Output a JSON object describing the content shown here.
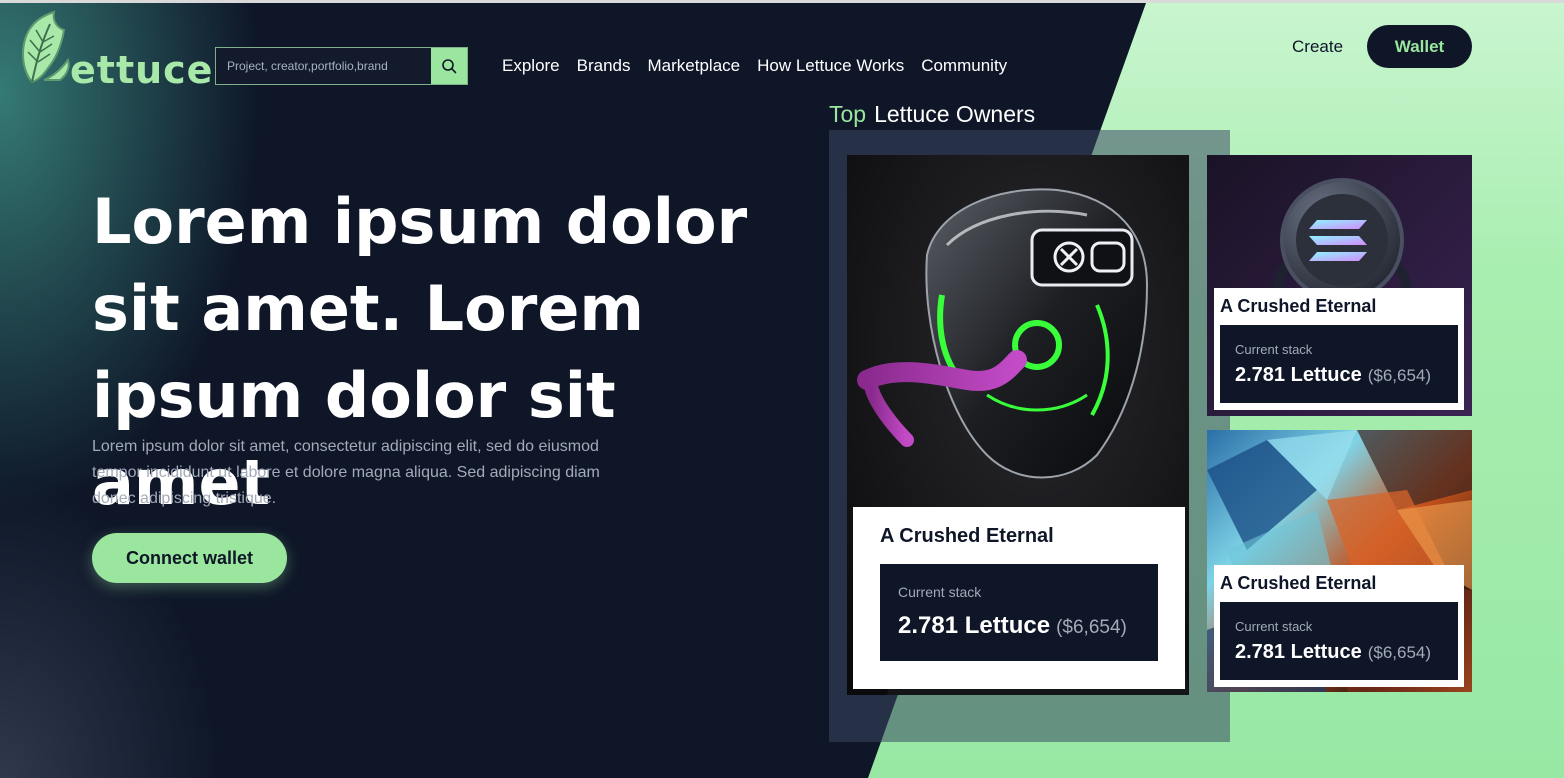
{
  "header": {
    "logo_text": "ettuce",
    "search": {
      "placeholder": "Project, creator,portfolio,brand"
    },
    "nav": [
      "Explore",
      "Brands",
      "Marketplace",
      "How Lettuce Works",
      "Community"
    ],
    "create_label": "Create",
    "wallet_label": "Wallet"
  },
  "hero": {
    "title": "Lorem ipsum dolor sit amet. Lorem ipsum dolor sit amet",
    "description": "Lorem ipsum dolor sit amet, consectetur adipiscing elit, sed do eiusmod tempor incididunt ut labore et dolore magna aliqua. Sed adipiscing diam donec adipiscing tristique.",
    "cta_label": "Connect wallet"
  },
  "owners": {
    "title_highlight": "Top",
    "title_rest": "Lettuce Owners",
    "cards": [
      {
        "name": "A Crushed Eternal",
        "stack_label": "Current stack",
        "amount": "2.781 Lettuce",
        "usd": "($6,654)",
        "image": "robot-helmet-art"
      },
      {
        "name": "A Crushed Eternal",
        "stack_label": "Current stack",
        "amount": "2.781 Lettuce",
        "usd": "($6,654)",
        "image": "solana-coin-art"
      },
      {
        "name": "A Crushed Eternal",
        "stack_label": "Current stack",
        "amount": "2.781 Lettuce",
        "usd": "($6,654)",
        "image": "crumpled-foil-art"
      }
    ]
  },
  "colors": {
    "background": "#0e1628",
    "accent_green": "#9ae69e",
    "light_green": "#c9f5cf",
    "muted_text": "#a3abb8",
    "white": "#ffffff"
  }
}
